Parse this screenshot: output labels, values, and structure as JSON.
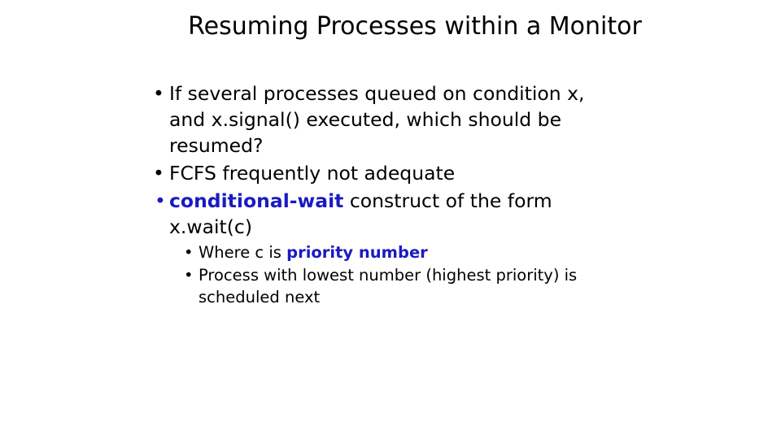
{
  "slide": {
    "title": "Resuming Processes within a Monitor",
    "background_color": "#ffffff",
    "text_color": "#000000",
    "accent_color": "#1a1ac4",
    "bullet_glyph": "•"
  },
  "bullets": [
    {
      "marker": "•",
      "marker_color": "#000000",
      "text": "If several processes queued on condition x, and x.signal() executed, which should be resumed?",
      "emphasis": null
    },
    {
      "marker": "•",
      "marker_color": "#000000",
      "text": "FCFS frequently not adequate",
      "emphasis": null
    },
    {
      "marker": "•",
      "marker_color": "#1a1ac4",
      "emphasis": "conditional-wait",
      "text_after_emphasis": " construct of the form",
      "second_line": "x.wait(c)",
      "subbullets": [
        {
          "marker": "•",
          "text_before_emphasis": "Where c is ",
          "emphasis": "priority number",
          "text_after_emphasis": ""
        },
        {
          "marker": "•",
          "text_before_emphasis": "",
          "emphasis": null,
          "text": "Process with lowest number (highest priority) is scheduled next"
        }
      ]
    }
  ]
}
